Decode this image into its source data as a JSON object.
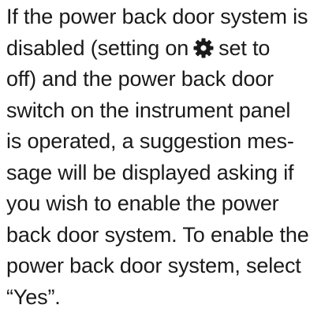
{
  "paragraph": {
    "lines": [
      "If the power back door system is",
      "disabled (setting on",
      "set to",
      "off) and the power back door",
      "switch on the instrument panel",
      "is operated, a suggestion mes-",
      "sage will be displayed asking if",
      "you wish to enable the power",
      "back door system. To enable the",
      "power back door system, select",
      "“Yes”."
    ],
    "inline_icon": "gear-icon"
  }
}
